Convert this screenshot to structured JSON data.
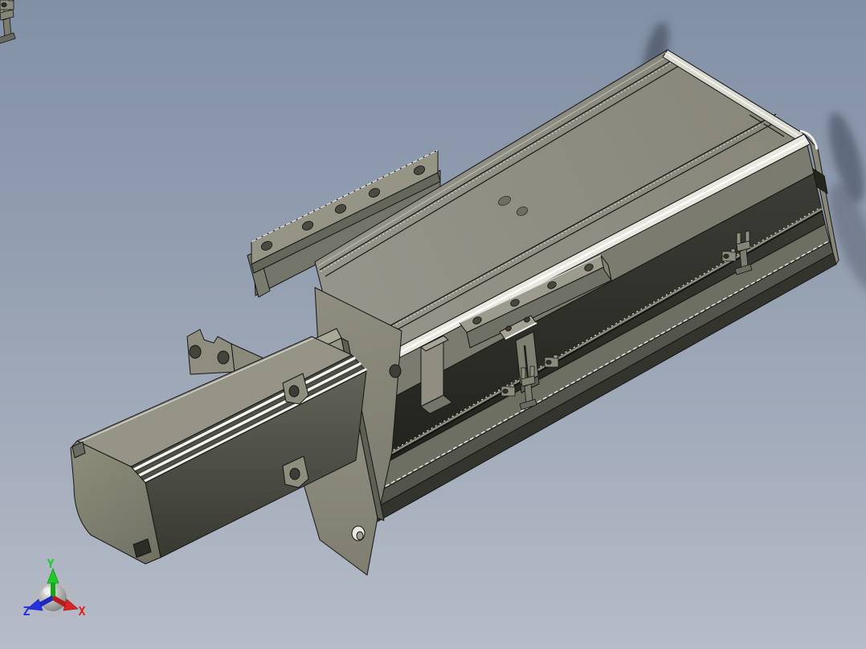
{
  "viewport": {
    "background": {
      "top": "#8290a6",
      "middle": "#96a1b2",
      "bottom": "#b6bcc8"
    },
    "shadow_color": "#3d4656"
  },
  "materials": {
    "body_top": "#8d8c82",
    "far_band": "#73746a",
    "side_upper": "#7b7c6f",
    "channel_dark": "#272823",
    "ledge": "#6e6f63",
    "bottom_dark": "#33342d",
    "end_face": "#898878",
    "mounting_strip": "#969585",
    "flange": "#8f8e7e",
    "block_top": "#959487",
    "block_side": "#4c4d44",
    "specular_highlight": "#f8f8f4",
    "edge_line": "#161614",
    "hole": "#45463e"
  },
  "triad": {
    "axes": [
      {
        "label": "Y",
        "color": "#1ecc26"
      },
      {
        "label": "Z",
        "color": "#2231e3"
      },
      {
        "label": "X",
        "color": "#dd2222"
      }
    ],
    "sphere_color": "#9a9a9a"
  }
}
